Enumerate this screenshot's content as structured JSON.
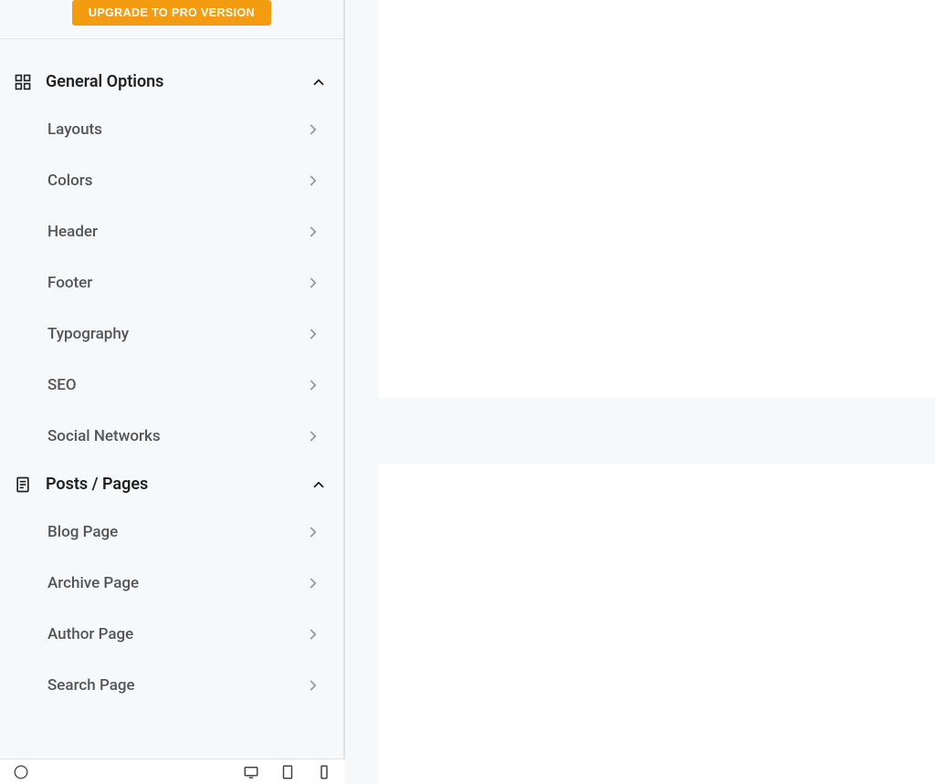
{
  "upgrade_label": "UPGRADE TO PRO VERSION",
  "sections": [
    {
      "title": "General Options",
      "items": [
        {
          "label": "Layouts"
        },
        {
          "label": "Colors"
        },
        {
          "label": "Header"
        },
        {
          "label": "Footer"
        },
        {
          "label": "Typography"
        },
        {
          "label": "SEO"
        },
        {
          "label": "Social Networks"
        }
      ]
    },
    {
      "title": "Posts / Pages",
      "items": [
        {
          "label": "Blog Page"
        },
        {
          "label": "Archive Page"
        },
        {
          "label": "Author Page"
        },
        {
          "label": "Search Page"
        }
      ]
    }
  ]
}
